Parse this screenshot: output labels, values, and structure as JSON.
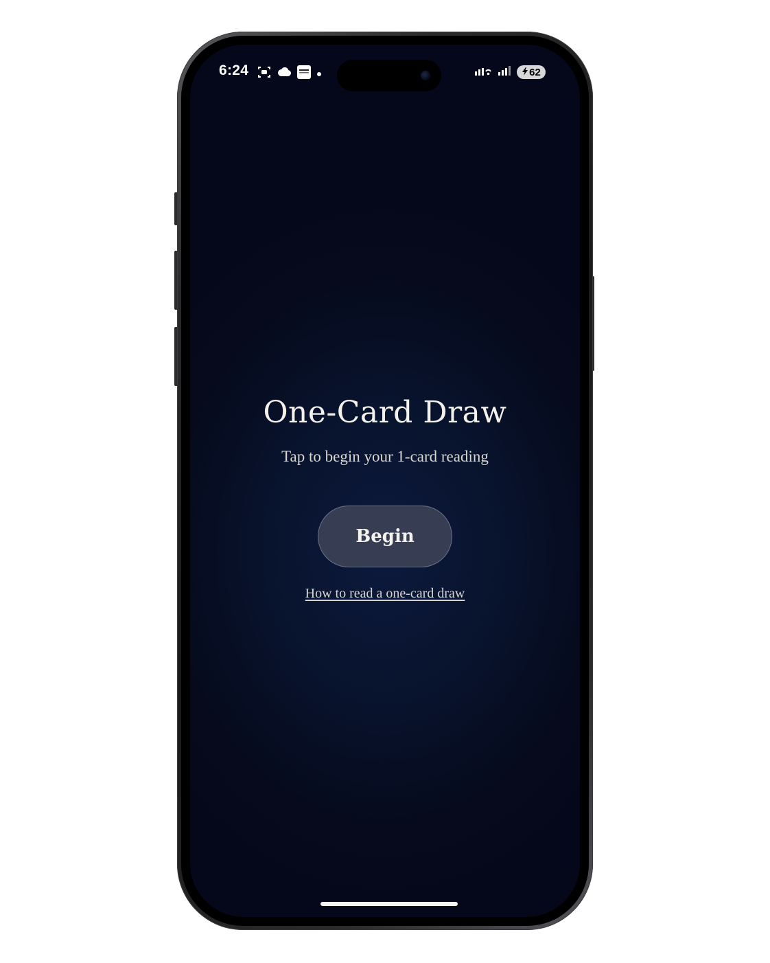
{
  "status_bar": {
    "time": "6:24",
    "battery_level": "62",
    "left_icons": [
      "screen-recording-icon",
      "cloud-icon",
      "app-notification-icon",
      "dot-icon"
    ],
    "right_icons": [
      "wifi-icon",
      "cellular-signal-icon",
      "battery-icon"
    ]
  },
  "main": {
    "title": "One-Card Draw",
    "subtitle": "Tap to begin your 1-card reading",
    "begin_label": "Begin",
    "guide_link": "How to read a one-card draw"
  },
  "colors": {
    "background": "#060a1c",
    "accent_glow": "#0c1a3d",
    "button_bg": "#373d52",
    "text": "#f3f1ec"
  }
}
